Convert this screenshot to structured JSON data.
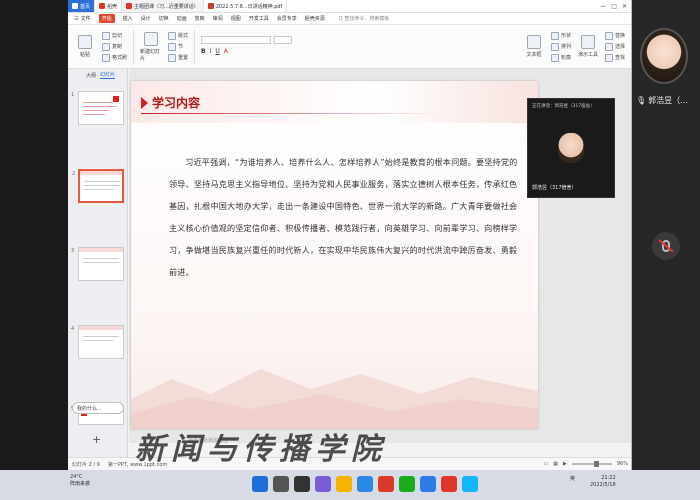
{
  "titlebar": {
    "home_label": "首页",
    "tabs": [
      {
        "label": "稻壳",
        "color": "#e0352b"
      },
      {
        "label": "主题团课（习...近重要讲话）",
        "color": "#e0352b"
      },
      {
        "label": "2022.5.7.8...日讲话精神.pdf",
        "color": "#d23a2a"
      }
    ],
    "controls": [
      "—",
      "□",
      "✕"
    ]
  },
  "menubar": {
    "file": "三 文件",
    "items": [
      "开始",
      "插入",
      "设计",
      "切换",
      "动画",
      "放映",
      "审阅",
      "视图",
      "开发工具",
      "会员专享",
      "稻壳资源"
    ],
    "active": "开始",
    "search": "Q 查找命令、搜索模板"
  },
  "ribbon": {
    "groups": [
      {
        "big": "粘贴",
        "small": [
          "剪切",
          "复制",
          "格式刷"
        ]
      },
      {
        "big": "新建幻灯片",
        "small": [
          "版式",
          "节",
          "重置"
        ]
      },
      {
        "big": "文本框",
        "small": [
          "形状",
          "排列",
          "轮廓"
        ]
      },
      {
        "big": "演示工具",
        "small": [
          "替换",
          "选择",
          "查找"
        ]
      }
    ]
  },
  "left_panel": {
    "tabs": [
      "大纲",
      "幻灯片"
    ],
    "active_tab": "幻灯片",
    "slide_numbers": [
      "1",
      "2",
      "3",
      "4",
      "5"
    ],
    "comment": "我的什么...",
    "add_slide": "+"
  },
  "slide": {
    "heading": "学习内容",
    "paragraph": "习近平强调，“为谁培养人、培养什么人、怎样培养人”始终是教育的根本问题。要坚持党的领导、坚持马克思主义指导地位、坚持为党和人民事业服务，落实立德树人根本任务，传承红色基因，扎根中国大地办大学，走出一条建设中国特色、世界一流大学的新路。广大青年要做社会主义核心价值观的坚定信仰者、积极传播者、模范践行者，向英雄学习、向前辈学习、向榜样学习，争做堪当民族复兴重任的时代新人，在实现中华民族伟大复兴的时代洪流中踔厉奋发、勇毅前进。"
  },
  "notes_hint": "单击此处添加备注",
  "statusbar": {
    "page": "幻灯片 2 / 9",
    "theme": "第一PPT, www.1ppt.com",
    "zoom": "96%"
  },
  "meeting_float": {
    "header": "正在讲话：郭浩昱（317宿舍）",
    "name": "郭浩昱（317宿舍）"
  },
  "participant": {
    "name": "郭浩昱（…"
  },
  "taskbar": {
    "temp": "24°C",
    "weather": "阵雨来袭",
    "time": "21:22",
    "date": "2022/5/18",
    "lang": "英"
  },
  "watermark": "新闻与传播学院",
  "colors": {
    "accent_red": "#c8202a",
    "wps_blue": "#2c6fd6"
  }
}
